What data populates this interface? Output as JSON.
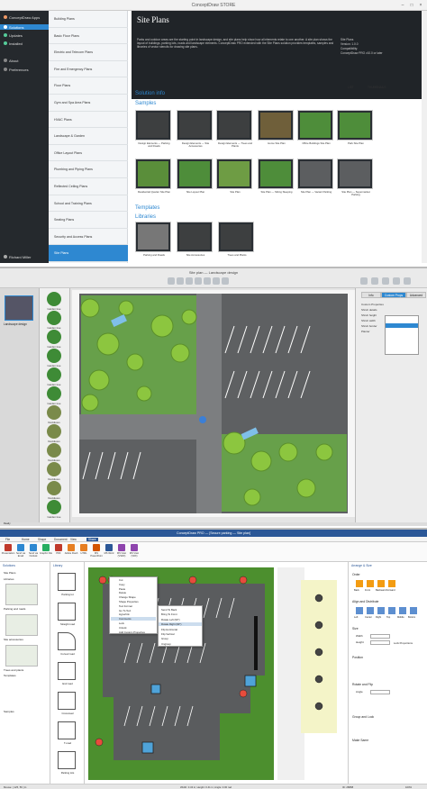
{
  "store": {
    "title": "ConceptDraw STORE",
    "user_link": "Richard Miller",
    "nav": [
      {
        "label": "ConceptDraw Apps",
        "selected": false
      },
      {
        "label": "Solutions",
        "selected": true
      },
      {
        "label": "Updates",
        "selected": false
      },
      {
        "label": "Installed",
        "selected": false
      },
      {
        "label": "About",
        "selected": false
      },
      {
        "label": "Preferences",
        "selected": false
      }
    ],
    "bottom_user": "Richard Miller",
    "solutions": [
      "Building Plans",
      "Basic Floor Plans",
      "Electric and Telecom Plans",
      "Fire and Emergency Plans",
      "Floor Plans",
      "Gym and Spa Area Plans",
      "HVAC Plans",
      "Landscape & Garden",
      "Office Layout Plans",
      "Plumbing and Piping Plans",
      "Reflected Ceiling Plans",
      "School and Training Plans",
      "Seating Plans",
      "Security and Access Plans",
      "Site Plans"
    ],
    "banner_title": "Site Plans",
    "banner_desc": "Parks and outdoor areas are the starting point in landscape design, and site plans help show how all elements relate to one another. A site plan shows the layout of buildings, parking lots, roads and landscape elements. ConceptDraw PRO extended with the Site Plans solution provides templates, samples and libraries of vector stencils for drawing site plans.",
    "banner_meta": {
      "title": "Site Plans",
      "version": "Version: 1.0.0",
      "compat": "Compatibility:",
      "compat_value": "ConceptDraw PRO v10.0 or later"
    },
    "sections": {
      "info": "Solution info",
      "samples": "Samples",
      "templates": "Templates",
      "libraries": "Libraries"
    },
    "toggle": [
      "LIST",
      "THUMBNAILS"
    ],
    "samples": [
      "Design Elements — Parking and Roads",
      "Design Elements — Site Accessories",
      "Design Elements — Trees and Plants",
      "Home Site Plan",
      "Office Buildings Site Plan",
      "Park Site Plan",
      "Residential Quarter Site Plan",
      "Site Layout Plan",
      "Site Plan",
      "Site Plan — Sitting Sleeping",
      "Site Plan — Vacant Parking",
      "Site Plan — Supermarket Parking"
    ],
    "libraries": [
      "Parking and Roads",
      "Site Accessories",
      "Trees and Plants"
    ]
  },
  "landscape": {
    "title": "Site plan — Landscape design",
    "pages_label": "Landscape design",
    "library_items": [
      "Garden tree",
      "Garden tree",
      "Garden tree",
      "Garden tree",
      "Garden tree",
      "Garden tree",
      "Deciduous",
      "Deciduous",
      "Deciduous",
      "Deciduous",
      "Deciduous",
      "Garden tree"
    ],
    "tabs": [
      "Info",
      "Custom Props",
      "Advanced"
    ],
    "props": [
      "Custom Properties",
      "Shrub details",
      "Shrub height",
      "Shrub width",
      "Shrub border",
      "Planter"
    ],
    "status": "Ready"
  },
  "parking": {
    "title": "ConceptDraw PRO — [Secure parking — Site plan]",
    "menu": [
      "File",
      "Home",
      "Shape",
      "Document",
      "View",
      "Share"
    ],
    "menu_active": "Share",
    "ribbon": [
      "Presentation",
      "Send via Email",
      "Send via Outlook",
      "Graphic File",
      "PDF",
      "Adobe Flash",
      "HTML",
      "MS PowerPoint",
      "MS Word",
      "MS Visio (VSDX)",
      "MS Visio (VDX)"
    ],
    "sol_header": "Solutions",
    "sol_items": [
      "Site Plans",
      "Libraries",
      "Parking and roads",
      "Site accessories",
      "Trees and plants",
      "Templates",
      "Samples"
    ],
    "lib_header": "Library",
    "lib_items": [
      "Parking lot",
      "Straight road",
      "Curved road",
      "End road",
      "Crossroad",
      "T-road",
      "Parking lots"
    ],
    "context_menu": [
      "Cut",
      "Copy",
      "Paste",
      "Delete",
      "Change Shape",
      "Shape Properties",
      "Text Format",
      "Go To Text",
      "Hyperlink",
      "Comments",
      "Lock",
      "Unlock",
      "Add Custom Properties"
    ],
    "submenu": [
      "Send To Back",
      "Bring To Front",
      "Rotate Left (90°)",
      "Rotate Right (90°)",
      "Flip Horizontal",
      "Flip Vertical",
      "Group",
      "Ungroup"
    ],
    "arrange_header": "Arrange & Size",
    "arrange_sections": [
      "Order",
      "Align and Distribute",
      "Size",
      "Position",
      "Rotate and Flip",
      "Group and Lock",
      "Make Same"
    ],
    "order_btns": [
      "Back",
      "Front",
      "Backward",
      "Forward"
    ],
    "align_btns": [
      "Left",
      "Center",
      "Right",
      "Top",
      "Middle",
      "Bottom"
    ],
    "size_fields": [
      "Width",
      "Height"
    ],
    "lock_label": "Lock Proportions",
    "angle_label": "Angle",
    "status": [
      "Mouse: [ 125, 56 ] in",
      "Width: 0.43 in; Height: 0.41 in; Angle: 0.00 rad",
      "ID: 28888"
    ],
    "zoom": "100%"
  }
}
